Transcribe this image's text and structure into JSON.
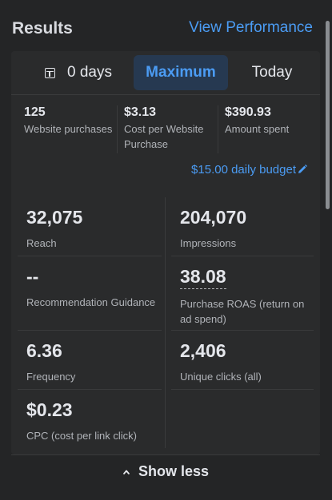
{
  "header": {
    "title": "Results",
    "link": "View Performance"
  },
  "tabs": [
    {
      "label": "0 days",
      "icon": "calendar-icon",
      "selected": false
    },
    {
      "label": "Maximum",
      "selected": true
    },
    {
      "label": "Today",
      "selected": false
    }
  ],
  "summary": [
    {
      "value": "125",
      "label": "Website purchases"
    },
    {
      "value": "$3.13",
      "label": "Cost per Website Purchase"
    },
    {
      "value": "$390.93",
      "label": "Amount spent"
    }
  ],
  "budget": {
    "label": "$15.00 daily budget",
    "icon": "pencil-icon"
  },
  "metrics": [
    {
      "value": "32,075",
      "label": "Reach"
    },
    {
      "value": "204,070",
      "label": "Impressions"
    },
    {
      "value": "--",
      "label": "Recommendation Guidance"
    },
    {
      "value": "38.08",
      "label": "Purchase ROAS (return on ad spend)"
    },
    {
      "value": "6.36",
      "label": "Frequency"
    },
    {
      "value": "2,406",
      "label": "Unique clicks (all)"
    },
    {
      "value": "$0.23",
      "label": "CPC (cost per link click)"
    }
  ],
  "footer": {
    "label": "Show less",
    "icon": "chevron-up-icon"
  },
  "colors": {
    "accent": "#4b9cf4",
    "background": "#242526",
    "card": "#2a2b2c"
  }
}
